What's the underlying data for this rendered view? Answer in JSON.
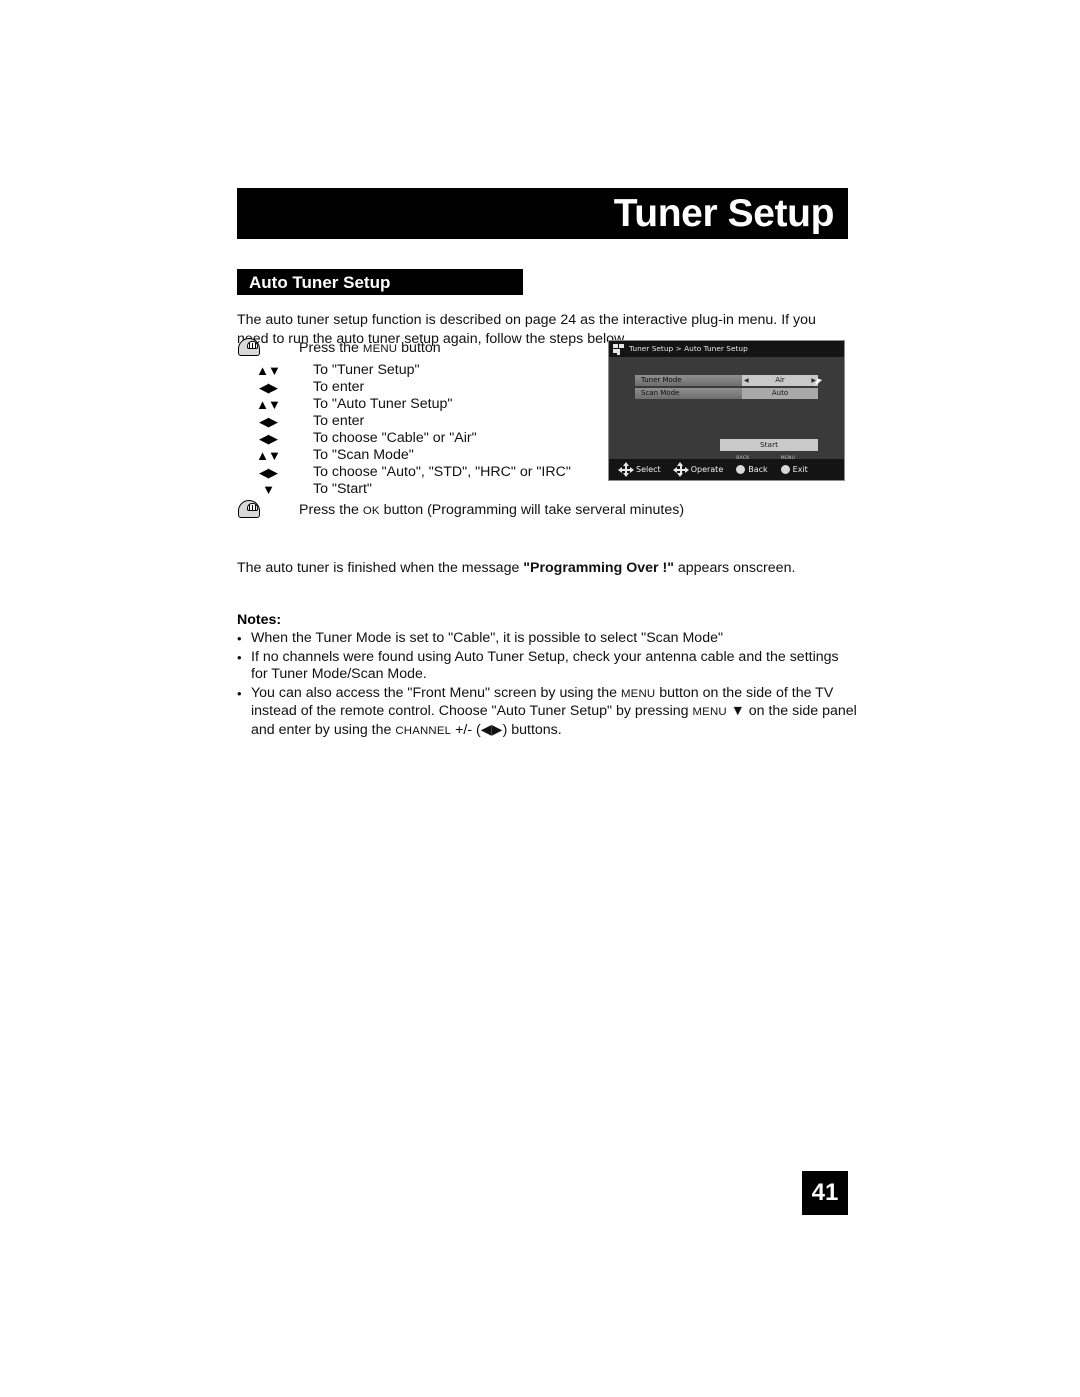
{
  "page": {
    "title": "Tuner Setup",
    "number": "41"
  },
  "section": {
    "heading": "Auto Tuner Setup",
    "intro": "The auto tuner setup function is described on page 24 as the interactive plug-in menu.  If you need to run the auto tuner setup again, follow the steps below."
  },
  "steps": [
    {
      "icon": "hand-press-icon",
      "glyph": "",
      "label_pre": "Press the ",
      "label_sc": "Menu",
      "label_post": " button"
    },
    {
      "icon": "up-down-arrows-icon",
      "glyph": "▲▼",
      "label_pre": "To \"Tuner Setup\"",
      "label_sc": "",
      "label_post": ""
    },
    {
      "icon": "left-right-arrows-icon",
      "glyph": "◀▶",
      "label_pre": "To enter",
      "label_sc": "",
      "label_post": ""
    },
    {
      "icon": "up-down-arrows-icon",
      "glyph": "▲▼",
      "label_pre": "To \"Auto Tuner Setup\"",
      "label_sc": "",
      "label_post": ""
    },
    {
      "icon": "left-right-arrows-icon",
      "glyph": "◀▶",
      "label_pre": "To enter",
      "label_sc": "",
      "label_post": ""
    },
    {
      "icon": "left-right-arrows-icon",
      "glyph": "◀▶",
      "label_pre": "To choose \"Cable\" or \"Air\"",
      "label_sc": "",
      "label_post": ""
    },
    {
      "icon": "up-down-arrows-icon",
      "glyph": "▲▼",
      "label_pre": "To \"Scan Mode\"",
      "label_sc": "",
      "label_post": ""
    },
    {
      "icon": "left-right-arrows-icon",
      "glyph": "◀▶",
      "label_pre": "To choose \"Auto\", \"STD\", \"HRC\" or \"IRC\"",
      "label_sc": "",
      "label_post": ""
    },
    {
      "icon": "down-arrow-icon",
      "glyph": "▼",
      "label_pre": "To \"Start\"",
      "label_sc": "",
      "label_post": ""
    },
    {
      "icon": "hand-press-icon",
      "glyph": "",
      "label_pre": "Press the ",
      "label_sc": "Ok",
      "label_post": " button (Programming will take serveral minutes)"
    }
  ],
  "tv_screen": {
    "breadcrumb": "Tuner Setup > Auto Tuner Setup",
    "rows": [
      {
        "label": "Tuner Mode",
        "value": "Air",
        "has_arrows": true
      },
      {
        "label": "Scan Mode",
        "value": "Auto",
        "has_arrows": false
      }
    ],
    "start_button": "Start",
    "footer": [
      {
        "icon": "dpad-icon",
        "label": "Select",
        "cap": ""
      },
      {
        "icon": "dpad-vertical-icon",
        "label": "Operate",
        "cap": ""
      },
      {
        "icon": "round-button-icon",
        "label": "Back",
        "cap": "BACK"
      },
      {
        "icon": "round-button-icon",
        "label": "Exit",
        "cap": "MENU"
      }
    ]
  },
  "closing": {
    "pre": "The auto tuner is finished when the message ",
    "bold": "\"Programming Over !\"",
    "post": " appears onscreen."
  },
  "notes": {
    "title": "Notes:",
    "bullet": "•",
    "items": [
      {
        "text": "When the Tuner Mode is set to \"Cable\", it is possible to select \"Scan Mode\""
      },
      {
        "text": "If no channels were found using Auto Tuner Setup, check your antenna cable and the settings for Tuner Mode/Scan Mode."
      },
      {
        "text": "You can also access the \"Front Menu\" screen by using the MENU button on the side of the TV instead of the remote control.  Choose \"Auto Tuner Setup\" by pressing MENU ▼ on the side panel and enter by using the CHANNEL +/- (◀▶) buttons."
      }
    ]
  },
  "colors": {
    "banner_bg": "#000000",
    "banner_text": "#ffffff",
    "tv_bg": "#3a3a3a",
    "tv_header_bg": "#141414",
    "tv_value_bg": "#c9c9c9"
  }
}
